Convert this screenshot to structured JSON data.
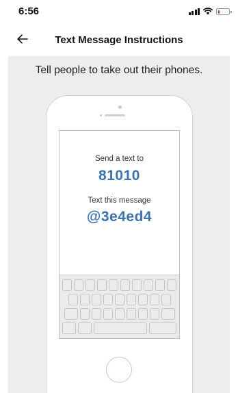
{
  "status_bar": {
    "time": "6:56",
    "icons": [
      "signal-icon",
      "wifi-icon",
      "battery-icon"
    ],
    "battery_level": 0.15,
    "battery_color": "#e5292a"
  },
  "nav": {
    "back_icon": "back-arrow-icon",
    "title": "Text Message Instructions"
  },
  "main": {
    "instruction": "Tell people to take out their phones.",
    "phone": {
      "send_label": "Send a text to",
      "number": "81010",
      "message_label": "Text this message",
      "code": "@3e4ed4"
    }
  },
  "colors": {
    "accent": "#3b73b3",
    "panel_background": "#ededed"
  }
}
